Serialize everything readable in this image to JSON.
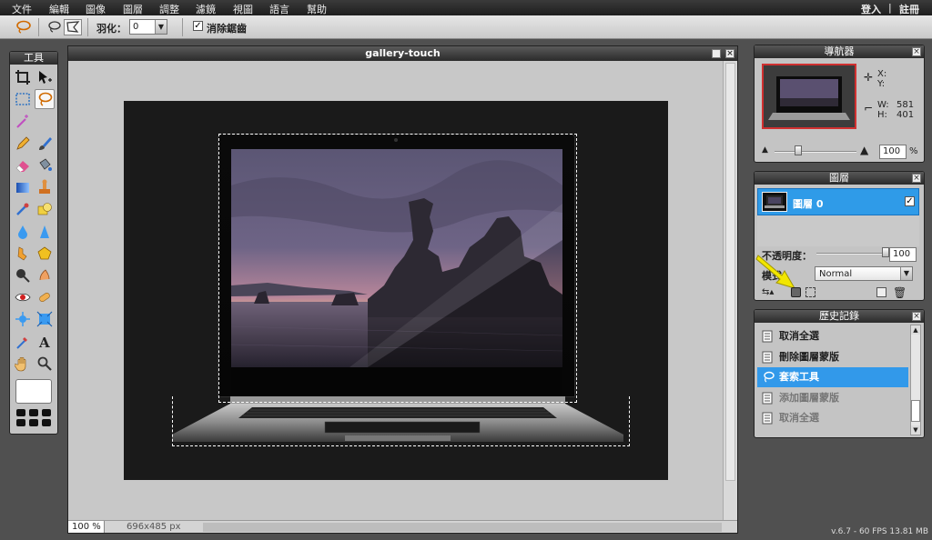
{
  "menu": {
    "items": [
      "文件",
      "編輯",
      "圖像",
      "圖層",
      "調整",
      "濾鏡",
      "視圖",
      "語言",
      "幫助"
    ],
    "login": "登入",
    "divider": "|",
    "register": "註冊"
  },
  "options": {
    "feather_label": "羽化：",
    "feather_value": "0",
    "antialias_label": "消除鋸齒",
    "antialias_checked": true
  },
  "tools_panel": {
    "title": "工具"
  },
  "document": {
    "title": "gallery-touch",
    "zoom": "100",
    "zoom_unit": "%",
    "dimensions": "696x485 px"
  },
  "navigator": {
    "title": "導航器",
    "x_label": "X:",
    "y_label": "Y:",
    "w_label": "W:",
    "w_value": "581",
    "h_label": "H:",
    "h_value": "401",
    "zoom_value": "100",
    "zoom_unit": "%"
  },
  "layers": {
    "title": "圖層",
    "layer_name": "圖層 0",
    "layer_visible": true,
    "opacity_label": "不透明度：",
    "opacity_value": "100",
    "opacity_fraction": 1.0,
    "mode_label": "模式：",
    "mode_value": "Normal"
  },
  "history": {
    "title": "歷史記錄",
    "items": [
      {
        "label": "取消全選",
        "state": "active"
      },
      {
        "label": "刪除圖層蒙版",
        "state": "active"
      },
      {
        "label": "套索工具",
        "state": "selected"
      },
      {
        "label": "添加圖層蒙版",
        "state": "undone"
      },
      {
        "label": "取消全選",
        "state": "undone"
      }
    ]
  },
  "footer": {
    "version": "v.6.7 - 60 FPS 13.81 MB"
  },
  "colors": {
    "accent": "#3299ea",
    "selection_border": "#d03030",
    "arrow_yellow": "#f2e600"
  }
}
